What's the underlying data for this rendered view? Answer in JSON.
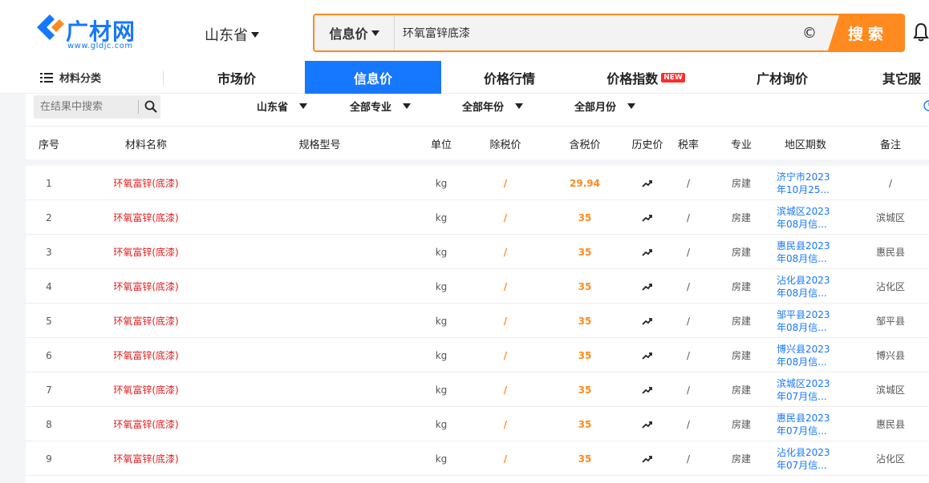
{
  "colors": {
    "brand": "#1677ff",
    "accent": "#ff8a1f",
    "name_red": "#e02020"
  },
  "header": {
    "logo_text": "广材网",
    "logo_sub": "www.gldjc.com",
    "region": "山东省",
    "search_type": "信息价",
    "search_value": "环氧富锌底漆",
    "search_button": "搜索"
  },
  "nav": {
    "category_label": "材料分类",
    "items": [
      {
        "label": "市场价"
      },
      {
        "label": "信息价"
      },
      {
        "label": "价格行情"
      },
      {
        "label": "价格指数",
        "badge": "NEW"
      },
      {
        "label": "广材询价"
      },
      {
        "label": "其它服"
      }
    ]
  },
  "filter": {
    "search_placeholder": "在结果中搜索",
    "dropdowns": [
      "山东省",
      "全部专业",
      "全部年份",
      "全部月份"
    ]
  },
  "table": {
    "headers": [
      "序号",
      "材料名称",
      "规格型号",
      "单位",
      "除税价",
      "含税价",
      "历史价",
      "税率",
      "专业",
      "地区期数",
      "备注"
    ],
    "rows": [
      {
        "no": "1",
        "name": "环氧富锌(底漆)",
        "spec": "",
        "unit": "kg",
        "pre_tax": "/",
        "tax_price": "29.94",
        "tax_rate": "/",
        "major": "房建",
        "period_1": "济宁市2023",
        "period_2": "年10月25...",
        "note": "/"
      },
      {
        "no": "2",
        "name": "环氧富锌(底漆)",
        "spec": "",
        "unit": "kg",
        "pre_tax": "/",
        "tax_price": "35",
        "tax_rate": "/",
        "major": "房建",
        "period_1": "滨城区2023",
        "period_2": "年08月信...",
        "note": "滨城区"
      },
      {
        "no": "3",
        "name": "环氧富锌(底漆)",
        "spec": "",
        "unit": "kg",
        "pre_tax": "/",
        "tax_price": "35",
        "tax_rate": "/",
        "major": "房建",
        "period_1": "惠民县2023",
        "period_2": "年08月信...",
        "note": "惠民县"
      },
      {
        "no": "4",
        "name": "环氧富锌(底漆)",
        "spec": "",
        "unit": "kg",
        "pre_tax": "/",
        "tax_price": "35",
        "tax_rate": "/",
        "major": "房建",
        "period_1": "沾化县2023",
        "period_2": "年08月信...",
        "note": "沾化区"
      },
      {
        "no": "5",
        "name": "环氧富锌(底漆)",
        "spec": "",
        "unit": "kg",
        "pre_tax": "/",
        "tax_price": "35",
        "tax_rate": "/",
        "major": "房建",
        "period_1": "邹平县2023",
        "period_2": "年08月信...",
        "note": "邹平县"
      },
      {
        "no": "6",
        "name": "环氧富锌(底漆)",
        "spec": "",
        "unit": "kg",
        "pre_tax": "/",
        "tax_price": "35",
        "tax_rate": "/",
        "major": "房建",
        "period_1": "博兴县2023",
        "period_2": "年08月信...",
        "note": "博兴县"
      },
      {
        "no": "7",
        "name": "环氧富锌(底漆)",
        "spec": "",
        "unit": "kg",
        "pre_tax": "/",
        "tax_price": "35",
        "tax_rate": "/",
        "major": "房建",
        "period_1": "滨城区2023",
        "period_2": "年07月信...",
        "note": "滨城区"
      },
      {
        "no": "8",
        "name": "环氧富锌(底漆)",
        "spec": "",
        "unit": "kg",
        "pre_tax": "/",
        "tax_price": "35",
        "tax_rate": "/",
        "major": "房建",
        "period_1": "惠民县2023",
        "period_2": "年07月信...",
        "note": "惠民县"
      },
      {
        "no": "9",
        "name": "环氧富锌(底漆)",
        "spec": "",
        "unit": "kg",
        "pre_tax": "/",
        "tax_price": "35",
        "tax_rate": "/",
        "major": "房建",
        "period_1": "沾化县2023",
        "period_2": "年07月信...",
        "note": "沾化区"
      }
    ]
  }
}
